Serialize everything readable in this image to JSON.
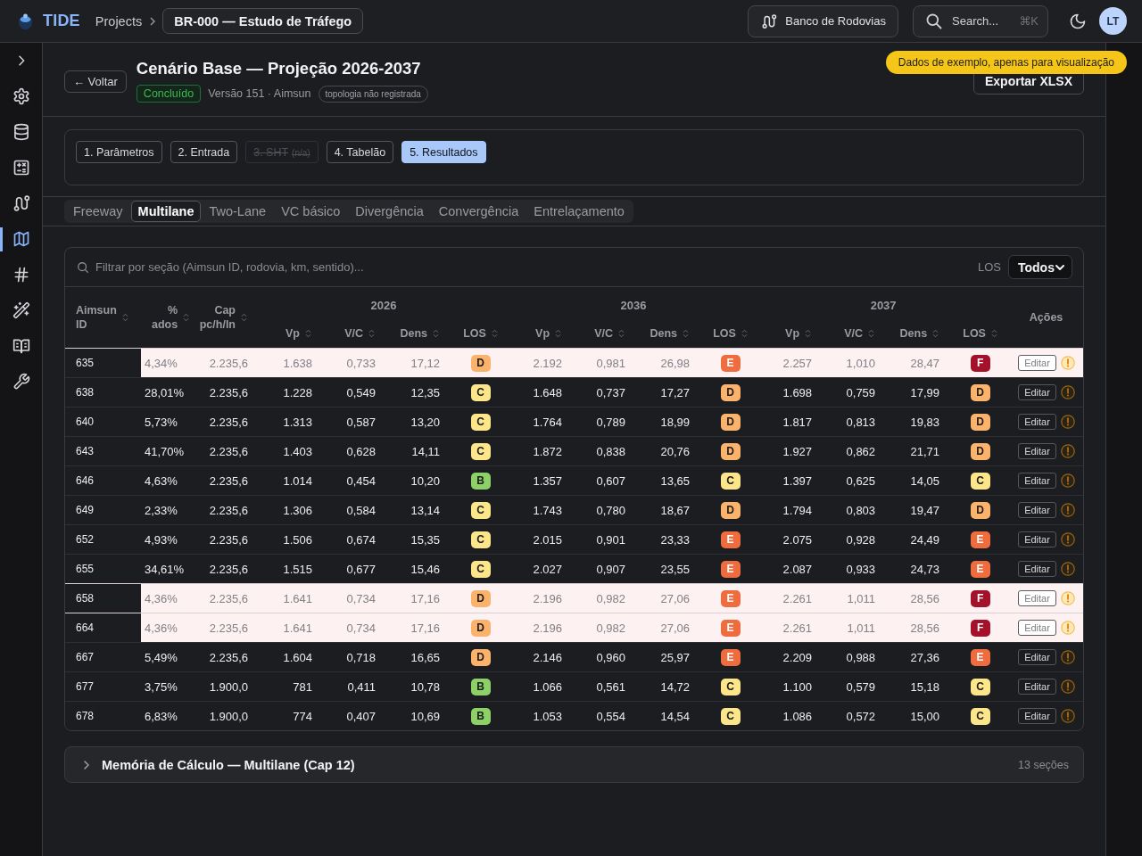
{
  "topbar": {
    "app_name": "TIDE",
    "breadcrumb": {
      "parent": "Projects",
      "current": "BR-000 — Estudo de Tráfego"
    },
    "roads_button": "Banco de Rodovias",
    "search": {
      "label": "Search...",
      "shortcut": "⌘K"
    },
    "avatar": "LT"
  },
  "sidebar": {
    "items": [
      {
        "kind": "expand",
        "selected": false
      },
      {
        "kind": "settings",
        "selected": false
      },
      {
        "kind": "database",
        "selected": false
      },
      {
        "kind": "calculator",
        "selected": false
      },
      {
        "kind": "route",
        "selected": false
      },
      {
        "kind": "map",
        "selected": true
      },
      {
        "kind": "hash",
        "selected": false
      },
      {
        "kind": "wand",
        "selected": false
      },
      {
        "kind": "book",
        "selected": false
      },
      {
        "kind": "wrench",
        "selected": false
      }
    ]
  },
  "header": {
    "back_button": "← Voltar",
    "title": "Cenário Base — Projeção 2026-2037",
    "status": "Concluído",
    "version": "Versão 151 · Aimsun",
    "topology_tag": "topologia não registrada",
    "export_button": "Exportar XLSX",
    "demo_banner": "Dados de exemplo, apenas para visualização"
  },
  "steps": [
    {
      "label": "1. Parâmetros",
      "selected": false,
      "disabled": false
    },
    {
      "label": "2. Entrada",
      "selected": false,
      "disabled": false
    },
    {
      "label": "3. SHT",
      "note": "(n/a)",
      "selected": false,
      "disabled": true
    },
    {
      "label": "4. Tabelão",
      "selected": false,
      "disabled": false
    },
    {
      "label": "5. Resultados",
      "selected": true,
      "disabled": false
    }
  ],
  "tabs": [
    {
      "label": "Freeway",
      "selected": false
    },
    {
      "label": "Multilane",
      "selected": true
    },
    {
      "label": "Two-Lane",
      "selected": false
    },
    {
      "label": "VC básico",
      "selected": false
    },
    {
      "label": "Divergência",
      "selected": false
    },
    {
      "label": "Convergência",
      "selected": false
    },
    {
      "label": "Entrelaçamento",
      "selected": false
    }
  ],
  "table": {
    "filter": {
      "placeholder": "Filtrar por seção (Aimsun ID, rodovia, km, sentido)...",
      "los_label": "LOS",
      "los_value": "Todos"
    },
    "columns": [
      {
        "label": "Aimsun ID"
      },
      {
        "label": "% ados"
      },
      {
        "label": "Cap pc/h/ln"
      }
    ],
    "year_groups": [
      {
        "year": "2026",
        "columns": [
          "Vp",
          "V/C",
          "Dens",
          "LOS"
        ]
      },
      {
        "year": "2036",
        "columns": [
          "Vp",
          "V/C",
          "Dens",
          "LOS"
        ]
      },
      {
        "year": "2037",
        "columns": [
          "Vp",
          "V/C",
          "Dens",
          "LOS"
        ]
      }
    ],
    "actions_header": "Ações",
    "rows": [
      {
        "id": "635",
        "pct": "4,34%",
        "cap": "2.235,6",
        "flagged": true,
        "action": "Editar",
        "years": [
          {
            "vp": "1.638",
            "vc": "0,733",
            "dens": "17,12",
            "los": "D",
            "color": "#fbb36b"
          },
          {
            "vp": "2.192",
            "vc": "0,981",
            "dens": "26,98",
            "los": "E",
            "color": "#ef6c3f"
          },
          {
            "vp": "2.257",
            "vc": "1,010",
            "dens": "28,47",
            "los": "F",
            "color": "#a3112b"
          }
        ]
      },
      {
        "id": "638",
        "pct": "28,01%",
        "cap": "2.235,6",
        "flagged": false,
        "action": "Editar",
        "years": [
          {
            "vp": "1.228",
            "vc": "0,549",
            "dens": "12,35",
            "los": "C",
            "color": "#fde58a"
          },
          {
            "vp": "1.648",
            "vc": "0,737",
            "dens": "17,27",
            "los": "D",
            "color": "#fbb36b"
          },
          {
            "vp": "1.698",
            "vc": "0,759",
            "dens": "17,99",
            "los": "D",
            "color": "#fbb36b"
          }
        ]
      },
      {
        "id": "640",
        "pct": "5,73%",
        "cap": "2.235,6",
        "flagged": false,
        "action": "Editar",
        "years": [
          {
            "vp": "1.313",
            "vc": "0,587",
            "dens": "13,20",
            "los": "C",
            "color": "#fde58a"
          },
          {
            "vp": "1.764",
            "vc": "0,789",
            "dens": "18,99",
            "los": "D",
            "color": "#fbb36b"
          },
          {
            "vp": "1.817",
            "vc": "0,813",
            "dens": "19,83",
            "los": "D",
            "color": "#fbb36b"
          }
        ]
      },
      {
        "id": "643",
        "pct": "41,70%",
        "cap": "2.235,6",
        "flagged": false,
        "action": "Editar",
        "years": [
          {
            "vp": "1.403",
            "vc": "0,628",
            "dens": "14,11",
            "los": "C",
            "color": "#fde58a"
          },
          {
            "vp": "1.872",
            "vc": "0,838",
            "dens": "20,76",
            "los": "D",
            "color": "#fbb36b"
          },
          {
            "vp": "1.927",
            "vc": "0,862",
            "dens": "21,71",
            "los": "D",
            "color": "#fbb36b"
          }
        ]
      },
      {
        "id": "646",
        "pct": "4,63%",
        "cap": "2.235,6",
        "flagged": false,
        "action": "Editar",
        "years": [
          {
            "vp": "1.014",
            "vc": "0,454",
            "dens": "10,20",
            "los": "B",
            "color": "#8dd067"
          },
          {
            "vp": "1.357",
            "vc": "0,607",
            "dens": "13,65",
            "los": "C",
            "color": "#fde58a"
          },
          {
            "vp": "1.397",
            "vc": "0,625",
            "dens": "14,05",
            "los": "C",
            "color": "#fde58a"
          }
        ]
      },
      {
        "id": "649",
        "pct": "2,33%",
        "cap": "2.235,6",
        "flagged": false,
        "action": "Editar",
        "years": [
          {
            "vp": "1.306",
            "vc": "0,584",
            "dens": "13,14",
            "los": "C",
            "color": "#fde58a"
          },
          {
            "vp": "1.743",
            "vc": "0,780",
            "dens": "18,67",
            "los": "D",
            "color": "#fbb36b"
          },
          {
            "vp": "1.794",
            "vc": "0,803",
            "dens": "19,47",
            "los": "D",
            "color": "#fbb36b"
          }
        ]
      },
      {
        "id": "652",
        "pct": "4,93%",
        "cap": "2.235,6",
        "flagged": false,
        "action": "Editar",
        "years": [
          {
            "vp": "1.506",
            "vc": "0,674",
            "dens": "15,35",
            "los": "C",
            "color": "#fde58a"
          },
          {
            "vp": "2.015",
            "vc": "0,901",
            "dens": "23,33",
            "los": "E",
            "color": "#ef6c3f"
          },
          {
            "vp": "2.075",
            "vc": "0,928",
            "dens": "24,49",
            "los": "E",
            "color": "#ef6c3f"
          }
        ]
      },
      {
        "id": "655",
        "pct": "34,61%",
        "cap": "2.235,6",
        "flagged": false,
        "action": "Editar",
        "years": [
          {
            "vp": "1.515",
            "vc": "0,677",
            "dens": "15,46",
            "los": "C",
            "color": "#fde58a"
          },
          {
            "vp": "2.027",
            "vc": "0,907",
            "dens": "23,55",
            "los": "E",
            "color": "#ef6c3f"
          },
          {
            "vp": "2.087",
            "vc": "0,933",
            "dens": "24,73",
            "los": "E",
            "color": "#ef6c3f"
          }
        ]
      },
      {
        "id": "658",
        "pct": "4,36%",
        "cap": "2.235,6",
        "flagged": true,
        "action": "Editar",
        "years": [
          {
            "vp": "1.641",
            "vc": "0,734",
            "dens": "17,16",
            "los": "D",
            "color": "#fbb36b"
          },
          {
            "vp": "2.196",
            "vc": "0,982",
            "dens": "27,06",
            "los": "E",
            "color": "#ef6c3f"
          },
          {
            "vp": "2.261",
            "vc": "1,011",
            "dens": "28,56",
            "los": "F",
            "color": "#a3112b"
          }
        ]
      },
      {
        "id": "664",
        "pct": "4,36%",
        "cap": "2.235,6",
        "flagged": true,
        "action": "Editar",
        "years": [
          {
            "vp": "1.641",
            "vc": "0,734",
            "dens": "17,16",
            "los": "D",
            "color": "#fbb36b"
          },
          {
            "vp": "2.196",
            "vc": "0,982",
            "dens": "27,06",
            "los": "E",
            "color": "#ef6c3f"
          },
          {
            "vp": "2.261",
            "vc": "1,011",
            "dens": "28,56",
            "los": "F",
            "color": "#a3112b"
          }
        ]
      },
      {
        "id": "667",
        "pct": "5,49%",
        "cap": "2.235,6",
        "flagged": false,
        "action": "Editar",
        "years": [
          {
            "vp": "1.604",
            "vc": "0,718",
            "dens": "16,65",
            "los": "D",
            "color": "#fbb36b"
          },
          {
            "vp": "2.146",
            "vc": "0,960",
            "dens": "25,97",
            "los": "E",
            "color": "#ef6c3f"
          },
          {
            "vp": "2.209",
            "vc": "0,988",
            "dens": "27,36",
            "los": "E",
            "color": "#ef6c3f"
          }
        ]
      },
      {
        "id": "677",
        "pct": "3,75%",
        "cap": "1.900,0",
        "flagged": false,
        "action": "Editar",
        "years": [
          {
            "vp": "781",
            "vc": "0,411",
            "dens": "10,78",
            "los": "B",
            "color": "#8dd067"
          },
          {
            "vp": "1.066",
            "vc": "0,561",
            "dens": "14,72",
            "los": "C",
            "color": "#fde58a"
          },
          {
            "vp": "1.100",
            "vc": "0,579",
            "dens": "15,18",
            "los": "C",
            "color": "#fde58a"
          }
        ]
      },
      {
        "id": "678",
        "pct": "6,83%",
        "cap": "1.900,0",
        "flagged": false,
        "action": "Editar",
        "years": [
          {
            "vp": "774",
            "vc": "0,407",
            "dens": "10,69",
            "los": "B",
            "color": "#8dd067"
          },
          {
            "vp": "1.053",
            "vc": "0,554",
            "dens": "14,54",
            "los": "C",
            "color": "#fde58a"
          },
          {
            "vp": "1.086",
            "vc": "0,572",
            "dens": "15,00",
            "los": "C",
            "color": "#fde58a"
          }
        ]
      }
    ]
  },
  "memory": {
    "title": "Memória de Cálculo — Multilane (Cap 12)",
    "count": "13 seções",
    "expanded": false
  }
}
